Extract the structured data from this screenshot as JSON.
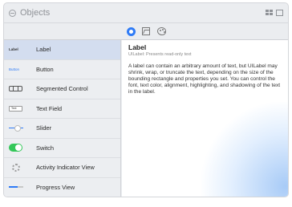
{
  "header": {
    "title": "Objects",
    "back_icon": "circle-arrow-icon",
    "right_icons": [
      "grid-icon",
      "square-icon"
    ]
  },
  "toolbar": {
    "buttons": [
      {
        "icon": "objects-circle-icon",
        "selected": true
      },
      {
        "icon": "image-icon",
        "selected": false
      },
      {
        "icon": "palette-icon",
        "selected": false
      }
    ]
  },
  "sidebar": {
    "items": [
      {
        "thumb_text": "Label",
        "label": "Label"
      },
      {
        "thumb_text": "Button",
        "label": "Button"
      },
      {
        "thumb_text": "",
        "label": "Segmented Control"
      },
      {
        "thumb_text": "Text",
        "label": "Text Field"
      },
      {
        "thumb_text": "",
        "label": "Slider"
      },
      {
        "thumb_text": "",
        "label": "Switch"
      },
      {
        "thumb_text": "",
        "label": "Activity Indicator View"
      },
      {
        "thumb_text": "",
        "label": "Progress View"
      }
    ],
    "selected_index": 0
  },
  "detail": {
    "title": "Label",
    "subtitle": "UILabel: Presents read-only text",
    "description": "A label can contain an arbitrary amount of text, but UILabel may shrink, wrap, or truncate the text, depending on the size of the bounding rectangle and properties you set. You can control the font, text color, alignment, highlighting, and shadowing of the text in the label."
  },
  "colors": {
    "accent": "#2f7bf6",
    "selected_row": "#d3ddef",
    "switch_on": "#34c759"
  }
}
